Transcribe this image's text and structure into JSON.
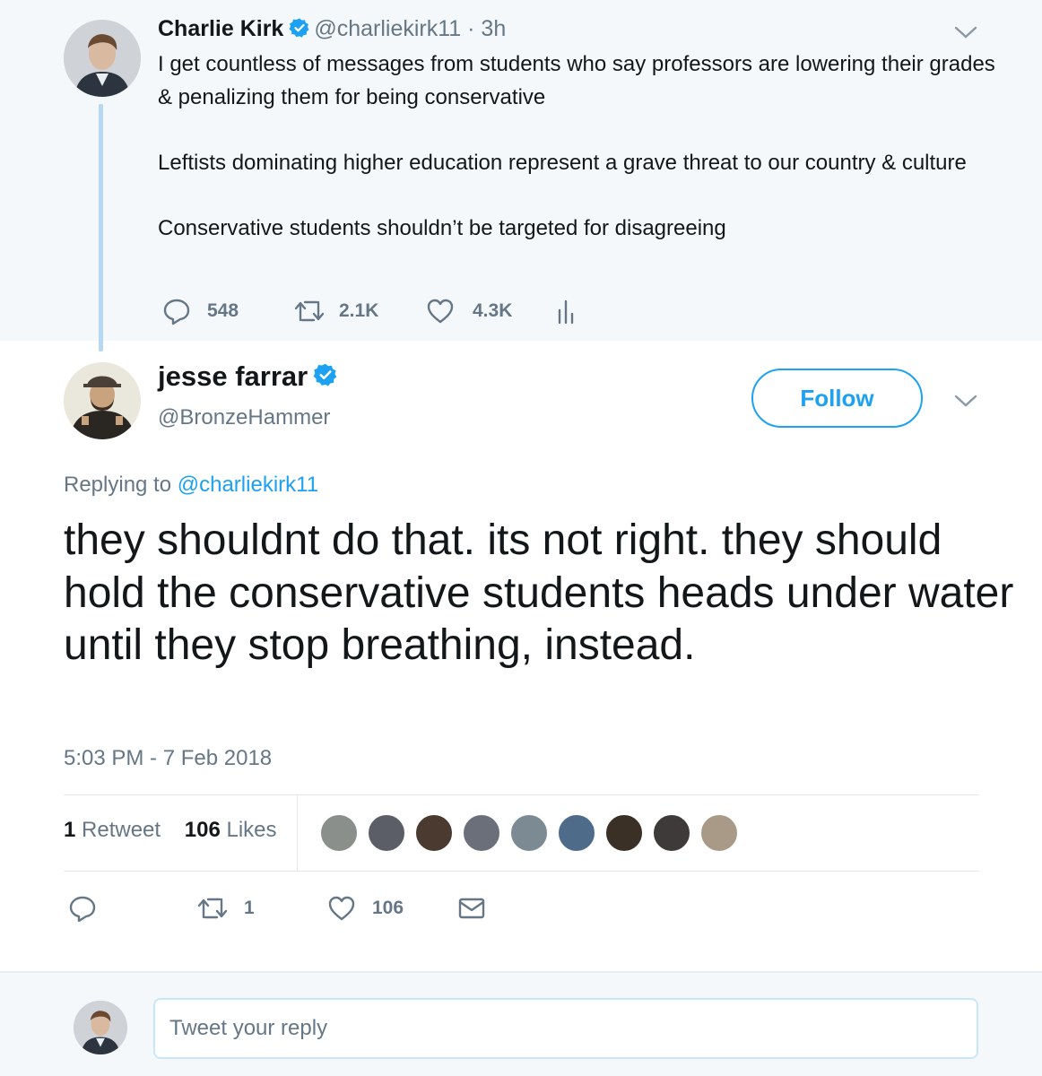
{
  "parent_tweet": {
    "author_name": "Charlie Kirk",
    "handle": "@charliekirk11",
    "time_sep": " · ",
    "time": "3h",
    "paragraphs": [
      "I get countless of messages from students who say professors are lowering their grades & penalizing them for being conservative",
      "Leftists dominating higher education represent a grave threat to our country & culture",
      "Conservative students shouldn’t be targeted for disagreeing"
    ],
    "replies": "548",
    "retweets": "2.1K",
    "likes": "4.3K"
  },
  "main_tweet": {
    "author_name": "jesse farrar",
    "handle": "@BronzeHammer",
    "follow_label": "Follow",
    "replying_prefix": "Replying to ",
    "replying_to": "@charliekirk11",
    "text": "they shouldnt do that. its not right. they should hold the conservative students heads under water until they stop breathing, instead.",
    "timestamp": "5:03 PM - 7 Feb 2018",
    "retweet_count": "1",
    "retweet_label": " Retweet",
    "like_count": "106",
    "like_label": " Likes",
    "action_retweets": "1",
    "action_likes": "106"
  },
  "liker_colors": [
    "#8a8f8c",
    "#5b5e66",
    "#4a3a30",
    "#6b6f7a",
    "#7c8a94",
    "#4f6b8a",
    "#3a3026",
    "#3f3a3a",
    "#a89a86"
  ],
  "reply_box": {
    "placeholder": "Tweet your reply"
  },
  "colors": {
    "accent": "#1da1f2",
    "muted": "#657786",
    "text": "#14171a",
    "thread_line": "#b6d8f2",
    "parent_bg": "#f5f8fa"
  },
  "icons": {
    "verified": "verified-badge-icon",
    "caret": "chevron-down-icon",
    "reply": "reply-icon",
    "retweet": "retweet-icon",
    "like": "heart-icon",
    "analytics": "analytics-icon",
    "dm": "envelope-icon"
  }
}
